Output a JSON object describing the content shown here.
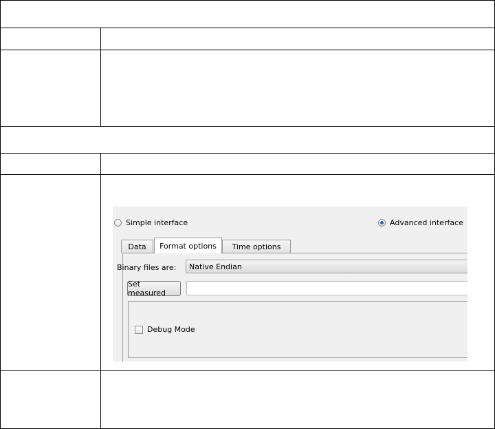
{
  "screenshot": {
    "radio_simple": {
      "label": "Simple interface",
      "selected": false
    },
    "radio_advanced": {
      "label": "Advanced interface",
      "selected": true
    },
    "tabs": [
      {
        "label": "Data",
        "active": false
      },
      {
        "label": "Format options",
        "active": true
      },
      {
        "label": "Time options",
        "active": false
      }
    ],
    "binary_label": "Binary files are:",
    "binary_value": "Native Endian",
    "set_measured_label": "Set measured",
    "set_measured_value": "",
    "debug_label": "Debug Mode",
    "debug_checked": false
  },
  "colors": {
    "radio_accent": "#2b64b8",
    "panel_background": "#f0f0f0"
  }
}
